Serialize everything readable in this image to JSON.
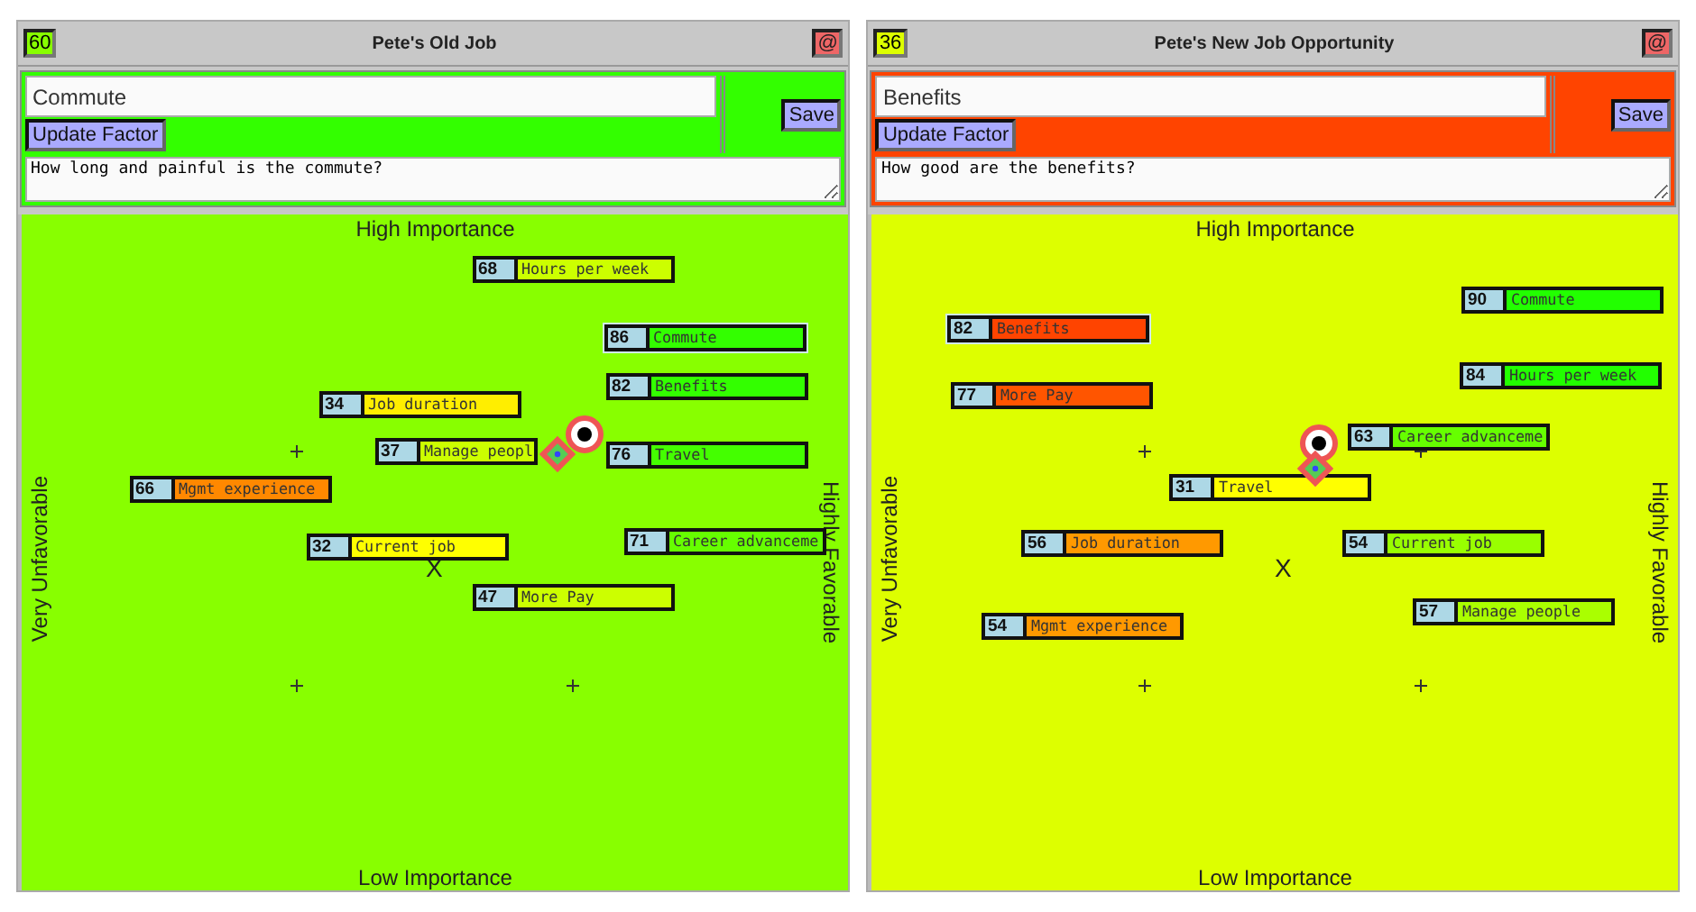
{
  "panels": [
    {
      "title": "Pete's Old Job",
      "score": "60",
      "color": "#88ff00",
      "close_label": "@",
      "factor_name": "Commute",
      "update_button": "Update Factor",
      "save_button": "Save",
      "description": "How long and painful is the commute?",
      "axis_top": "High Importance",
      "axis_bottom": "Low Importance",
      "axis_left": "Very Unfavorable",
      "axis_right": "Highly Favorable",
      "center_mark": "X",
      "factors": [
        {
          "score": "68",
          "label": "Hours per week",
          "color": "#ccff00",
          "selected": false
        },
        {
          "score": "86",
          "label": "Commute",
          "color": "#33ff00",
          "selected": true
        },
        {
          "score": "82",
          "label": "Benefits",
          "color": "#33ff00",
          "selected": false
        },
        {
          "score": "34",
          "label": "Job duration",
          "color": "#ffee00",
          "selected": false
        },
        {
          "score": "37",
          "label": "Manage peopl",
          "color": "#ccff00",
          "selected": false
        },
        {
          "score": "76",
          "label": "Travel",
          "color": "#44ff00",
          "selected": false
        },
        {
          "score": "66",
          "label": "Mgmt experience",
          "color": "#ff8800",
          "selected": false
        },
        {
          "score": "32",
          "label": "Current job",
          "color": "#ffff00",
          "selected": false
        },
        {
          "score": "71",
          "label": "Career advanceme",
          "color": "#66ff00",
          "selected": false
        },
        {
          "score": "47",
          "label": "More Pay",
          "color": "#ccff00",
          "selected": false
        }
      ]
    },
    {
      "title": "Pete's New Job Opportunity",
      "score": "36",
      "color": "#ddff00",
      "close_label": "@",
      "factor_name": "Benefits",
      "update_button": "Update Factor",
      "save_button": "Save",
      "description": "How good are the benefits?",
      "axis_top": "High Importance",
      "axis_bottom": "Low Importance",
      "axis_left": "Very Unfavorable",
      "axis_right": "Highly Favorable",
      "center_mark": "X",
      "factors": [
        {
          "score": "90",
          "label": "Commute",
          "color": "#22ff00",
          "selected": false
        },
        {
          "score": "82",
          "label": "Benefits",
          "color": "#ff4400",
          "selected": true
        },
        {
          "score": "84",
          "label": "Hours per week",
          "color": "#22ff00",
          "selected": false
        },
        {
          "score": "77",
          "label": "More Pay",
          "color": "#ff5500",
          "selected": false
        },
        {
          "score": "63",
          "label": "Career advanceme",
          "color": "#66ff00",
          "selected": false
        },
        {
          "score": "31",
          "label": "Travel",
          "color": "#ffff00",
          "selected": false
        },
        {
          "score": "56",
          "label": "Job duration",
          "color": "#ff9900",
          "selected": false
        },
        {
          "score": "54",
          "label": "Current job",
          "color": "#99ff00",
          "selected": false
        },
        {
          "score": "57",
          "label": "Manage people",
          "color": "#aaff00",
          "selected": false
        },
        {
          "score": "54",
          "label": "Mgmt experience",
          "color": "#ff9900",
          "selected": false
        }
      ]
    }
  ]
}
